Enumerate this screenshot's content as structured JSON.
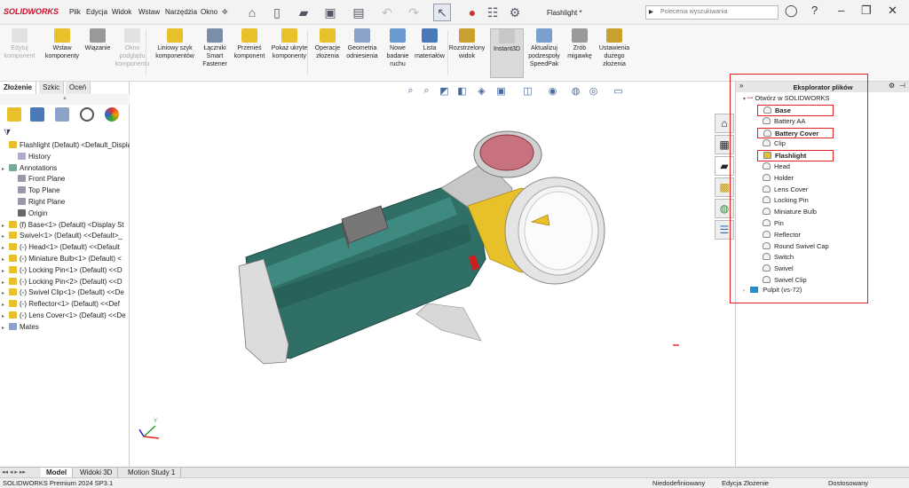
{
  "app": {
    "logo": "SOLIDWORKS",
    "document_title": "Flashlight *"
  },
  "menu": [
    "Plik",
    "Edycja",
    "Widok",
    "Wstaw",
    "Narzędzia",
    "Okno"
  ],
  "search": {
    "placeholder": "Polecenia wyszukiwania"
  },
  "ribbon": [
    {
      "label": "Edytuj komponent",
      "disabled": true
    },
    {
      "label": "Wstaw komponenty",
      "disabled": false
    },
    {
      "label": "Wiązanie",
      "disabled": false
    },
    {
      "label": "Okno podglądu komponentu",
      "disabled": true
    },
    {
      "label": "Liniowy szyk komponentów",
      "disabled": false
    },
    {
      "label": "Łączniki Smart Fastener",
      "disabled": false
    },
    {
      "label": "Przenieś komponent",
      "disabled": false
    },
    {
      "label": "Pokaż ukryte komponenty",
      "disabled": false
    },
    {
      "label": "Operacje złożenia",
      "disabled": false
    },
    {
      "label": "Geometria odniesienia",
      "disabled": false
    },
    {
      "label": "Nowe badanie ruchu",
      "disabled": false
    },
    {
      "label": "Lista materiałów",
      "disabled": false
    },
    {
      "label": "Rozstrzelony widok",
      "disabled": false
    },
    {
      "label": "Instant3D",
      "disabled": false,
      "active": true
    },
    {
      "label": "Aktualizuj podzespoły SpeedPak",
      "disabled": false
    },
    {
      "label": "Zrób migawkę",
      "disabled": false
    },
    {
      "label": "Ustawienia dużego złożenia",
      "disabled": false
    }
  ],
  "left_tabs": [
    "Złożenie",
    "Szkic",
    "Oceń"
  ],
  "feature_tree": [
    {
      "label": "Flashlight (Default) <Default_Display",
      "indent": 0,
      "arrow": false
    },
    {
      "label": "History",
      "indent": 1,
      "arrow": false
    },
    {
      "label": "Annotations",
      "indent": 0,
      "arrow": true
    },
    {
      "label": "Front Plane",
      "indent": 1,
      "arrow": false
    },
    {
      "label": "Top Plane",
      "indent": 1,
      "arrow": false
    },
    {
      "label": "Right Plane",
      "indent": 1,
      "arrow": false
    },
    {
      "label": "Origin",
      "indent": 1,
      "arrow": false
    },
    {
      "label": "(f) Base<1> (Default) <Display St",
      "indent": 0,
      "arrow": true
    },
    {
      "label": "Swivel<1> (Default) <<Default>_",
      "indent": 0,
      "arrow": true
    },
    {
      "label": "(-) Head<1> (Default) <<Default",
      "indent": 0,
      "arrow": true
    },
    {
      "label": "(-) Miniature Bulb<1> (Default) <",
      "indent": 0,
      "arrow": true
    },
    {
      "label": "(-) Locking Pin<1> (Default) <<D",
      "indent": 0,
      "arrow": true
    },
    {
      "label": "(-) Locking Pin<2> (Default) <<D",
      "indent": 0,
      "arrow": true
    },
    {
      "label": "(-) Swivel Clip<1> (Default) <<De",
      "indent": 0,
      "arrow": true
    },
    {
      "label": "(-) Reflector<1> (Default) <<Def",
      "indent": 0,
      "arrow": true
    },
    {
      "label": "(-) Lens Cover<1> (Default) <<De",
      "indent": 0,
      "arrow": true
    },
    {
      "label": "Mates",
      "indent": 0,
      "arrow": true
    }
  ],
  "explorer": {
    "title": "Eksplorator plików",
    "root": "Otwórz w SOLIDWORKS",
    "files": [
      {
        "label": "Base",
        "bold": true,
        "highlighted": true
      },
      {
        "label": "Battery AA",
        "bold": false,
        "highlighted": false
      },
      {
        "label": "Battery Cover",
        "bold": true,
        "highlighted": true
      },
      {
        "label": "Clip",
        "bold": false,
        "highlighted": false
      },
      {
        "label": "Flashlight",
        "bold": true,
        "highlighted": true
      },
      {
        "label": "Head",
        "bold": false,
        "highlighted": false
      },
      {
        "label": "Holder",
        "bold": false,
        "highlighted": false
      },
      {
        "label": "Lens Cover",
        "bold": false,
        "highlighted": false
      },
      {
        "label": "Locking Pin",
        "bold": false,
        "highlighted": false
      },
      {
        "label": "Miniature Bulb",
        "bold": false,
        "highlighted": false
      },
      {
        "label": "Pin",
        "bold": false,
        "highlighted": false
      },
      {
        "label": "Reflector",
        "bold": false,
        "highlighted": false
      },
      {
        "label": "Round Swivel Cap",
        "bold": false,
        "highlighted": false
      },
      {
        "label": "Switch",
        "bold": false,
        "highlighted": false
      },
      {
        "label": "Swivel",
        "bold": false,
        "highlighted": false
      },
      {
        "label": "Swivel Clip",
        "bold": false,
        "highlighted": false
      }
    ],
    "desktop": "Pulpit (vs-72)"
  },
  "bottom_tabs": [
    "Model",
    "Widoki 3D",
    "Motion Study 1"
  ],
  "status": {
    "product": "SOLIDWORKS Premium 2024 SP3.1",
    "state": "Niedodefiniowany",
    "mode": "Edycja Złożenie",
    "custom": "Dostosowany"
  },
  "colors": {
    "accent": "#c8102e",
    "highlight_box": "#e02020",
    "body_green": "#2f6f66",
    "yellow": "#e8c02a"
  }
}
